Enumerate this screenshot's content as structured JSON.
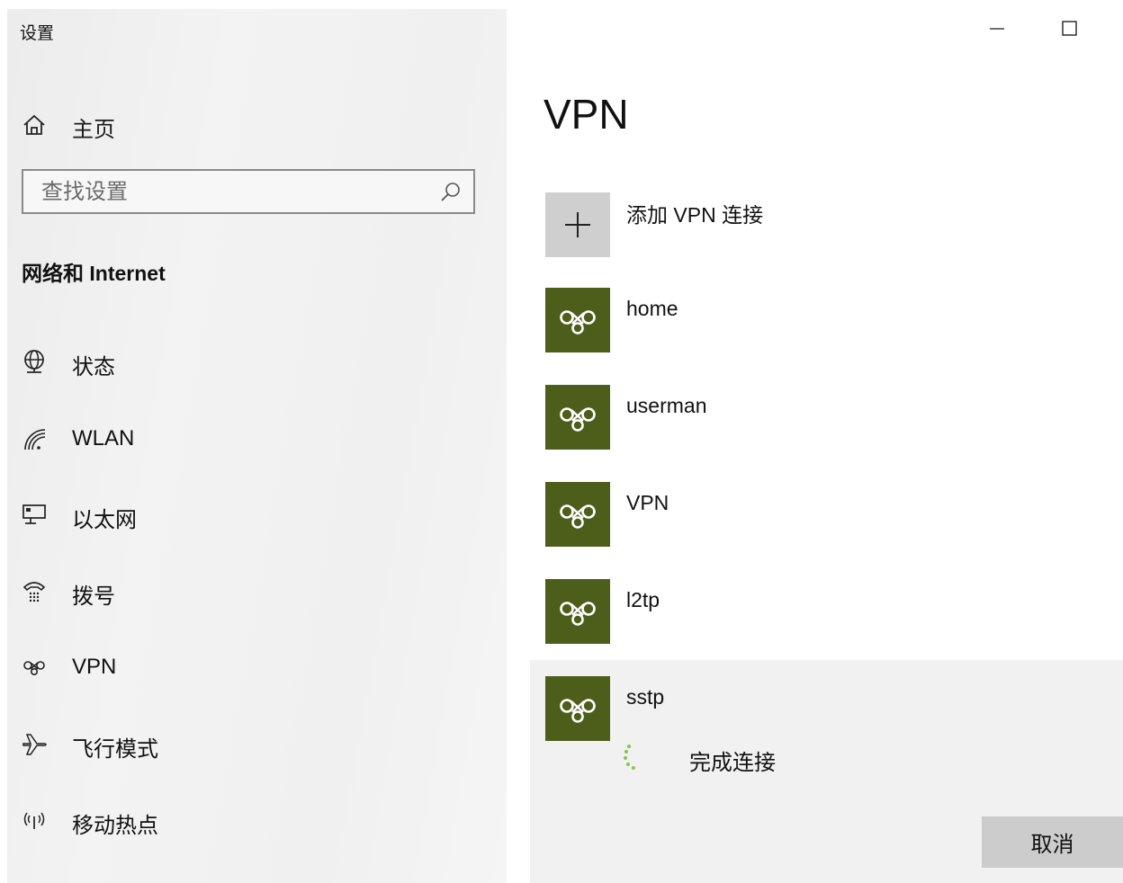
{
  "window": {
    "title": "设置",
    "minimize_label": "Minimize",
    "maximize_label": "Maximize"
  },
  "sidebar": {
    "home": {
      "label": "主页",
      "icon": "home-icon"
    },
    "search": {
      "placeholder": "查找设置",
      "value": "",
      "icon": "search-icon"
    },
    "section_title": "网络和 Internet",
    "items": [
      {
        "label": "状态",
        "icon": "globe-icon"
      },
      {
        "label": "WLAN",
        "icon": "wifi-icon"
      },
      {
        "label": "以太网",
        "icon": "ethernet-icon"
      },
      {
        "label": "拨号",
        "icon": "dialup-icon"
      },
      {
        "label": "VPN",
        "icon": "vpn-icon"
      },
      {
        "label": "飞行模式",
        "icon": "airplane-icon"
      },
      {
        "label": "移动热点",
        "icon": "hotspot-icon"
      }
    ]
  },
  "main": {
    "title": "VPN",
    "add_connection": {
      "label": "添加 VPN 连接",
      "icon": "plus-icon"
    },
    "connections": [
      {
        "name": "home"
      },
      {
        "name": "userman"
      },
      {
        "name": "VPN"
      },
      {
        "name": "l2tp"
      },
      {
        "name": "sstp",
        "selected": true,
        "status": "完成连接",
        "cancel_label": "取消"
      }
    ]
  },
  "colors": {
    "vpn_tile": "#4d5e1b",
    "add_tile": "#cfcfcf",
    "selected_bg": "#f1f1f1",
    "spinner": "#8bc34a",
    "cancel_button": "#cccccc"
  }
}
